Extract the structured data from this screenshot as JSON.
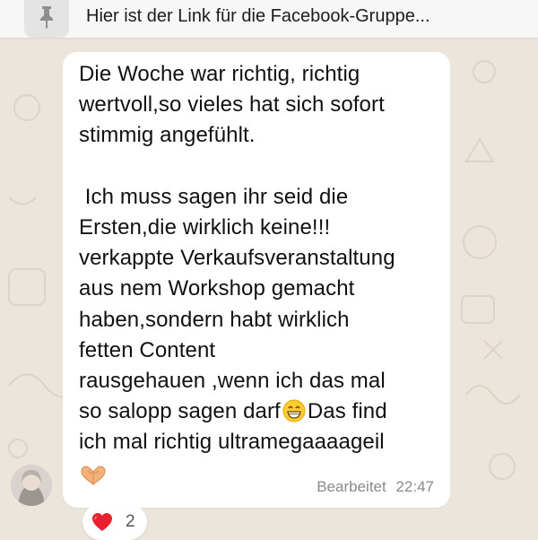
{
  "pinned": {
    "icon": "pin-icon",
    "text": "Hier ist der Link für die Facebook-Gruppe..."
  },
  "message": {
    "lines": [
      "Die Woche war richtig, richtig",
      "wertvoll,so vieles hat sich sofort",
      "stimmig angefühlt.",
      "",
      " Ich muss sagen ihr seid die",
      "Ersten,die wirklich keine!!!",
      "verkappte Verkaufsveranstaltung",
      "aus nem Workshop gemacht",
      "haben,sondern habt wirklich",
      "fetten Content",
      "rausgehauen ,wenn ich das mal"
    ],
    "line_emoji_a": "so salopp sagen darf",
    "line_emoji_b": "Das find",
    "last_line": "ich mal richtig ultramegaaaageil",
    "emoji_grin": "grinning-face-icon",
    "emoji_hands": "heart-hands-icon",
    "edited_label": "Bearbeitet",
    "time": "22:47"
  },
  "sender": {
    "avatar": "avatar"
  },
  "reaction": {
    "icon": "heart-icon",
    "count": "2"
  },
  "colors": {
    "wallpaper": "#ece5dc",
    "bubble": "#ffffff",
    "pinned_bar": "#f7f7f7",
    "meta_text": "#8a8a8a",
    "heart": "#e8202f"
  }
}
